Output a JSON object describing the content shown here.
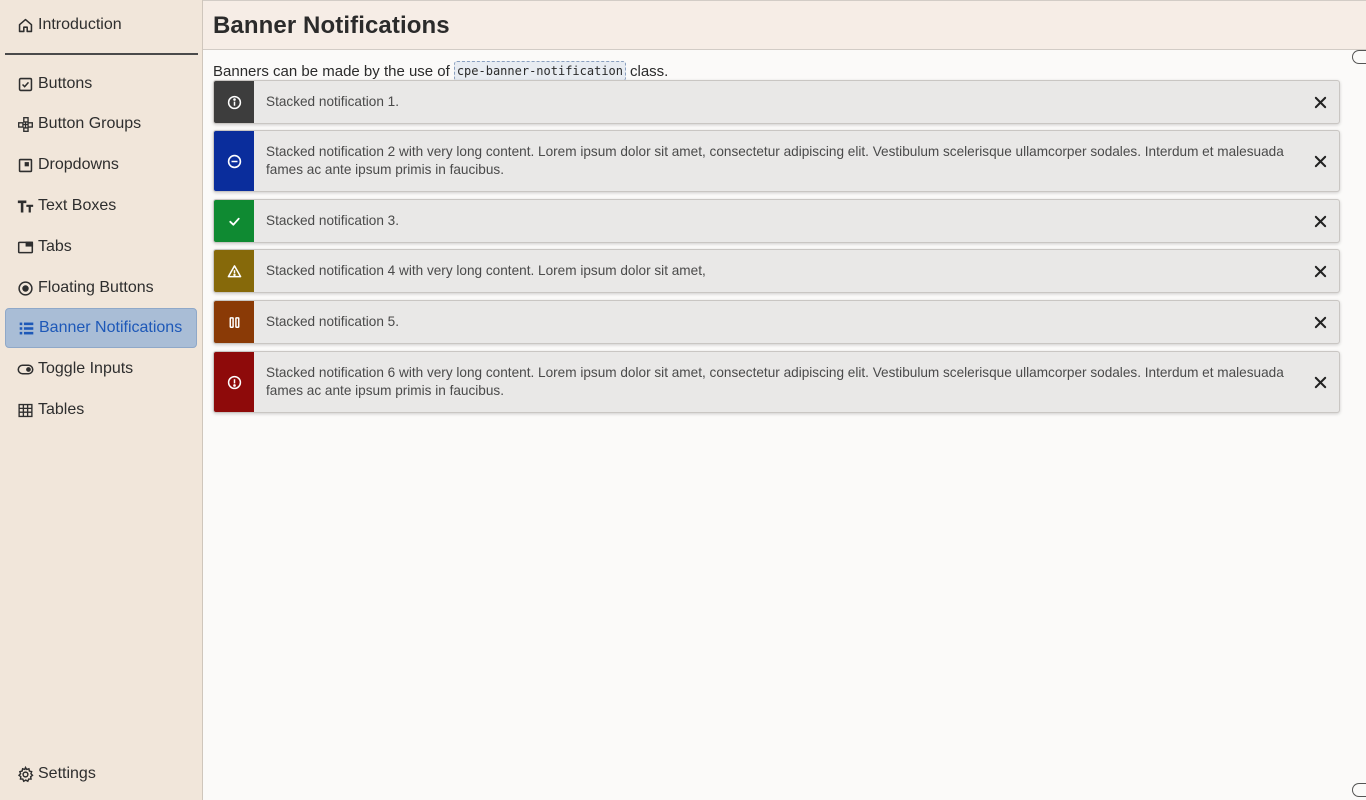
{
  "sidebar": {
    "items": [
      {
        "label": "Introduction",
        "icon": "home-icon"
      },
      {
        "label": "Buttons",
        "icon": "checkbox-icon"
      },
      {
        "label": "Button Groups",
        "icon": "button-groups-icon"
      },
      {
        "label": "Dropdowns",
        "icon": "dropdown-icon"
      },
      {
        "label": "Text Boxes",
        "icon": "text-icon"
      },
      {
        "label": "Tabs",
        "icon": "tabs-icon"
      },
      {
        "label": "Floating Buttons",
        "icon": "radio-icon"
      },
      {
        "label": "Banner Notifications",
        "icon": "list-icon",
        "active": true
      },
      {
        "label": "Toggle Inputs",
        "icon": "toggle-icon"
      },
      {
        "label": "Tables",
        "icon": "table-icon"
      }
    ],
    "settings_label": "Settings"
  },
  "header": {
    "title": "Banner Notifications"
  },
  "main": {
    "intro_before": "Banners can be made by the use of",
    "intro_code": "cpe-banner-notification",
    "intro_after": "class.",
    "banners": [
      {
        "text": "Stacked notification 1.",
        "color": "#3d3d3d",
        "icon": "info-icon"
      },
      {
        "text": "Stacked notification 2 with very long content. Lorem ipsum dolor sit amet, consectetur adipiscing elit. Vestibulum scelerisque ullamcorper sodales. Interdum et malesuada fames ac ante ipsum primis in faucibus.",
        "color": "#0a2d9c",
        "icon": "minus-circle-icon"
      },
      {
        "text": "Stacked notification 3.",
        "color": "#0f8a32",
        "icon": "check-icon"
      },
      {
        "text": "Stacked notification 4 with very long content. Lorem ipsum dolor sit amet,",
        "color": "#86690a",
        "icon": "warning-icon"
      },
      {
        "text": "Stacked notification 5.",
        "color": "#8a3a06",
        "icon": "pause-icon"
      },
      {
        "text": "Stacked notification 6 with very long content. Lorem ipsum dolor sit amet, consectetur adipiscing elit. Vestibulum scelerisque ullamcorper sodales. Interdum et malesuada fames ac ante ipsum primis in faucibus.",
        "color": "#8e0a0a",
        "icon": "alert-circle-icon"
      }
    ]
  }
}
